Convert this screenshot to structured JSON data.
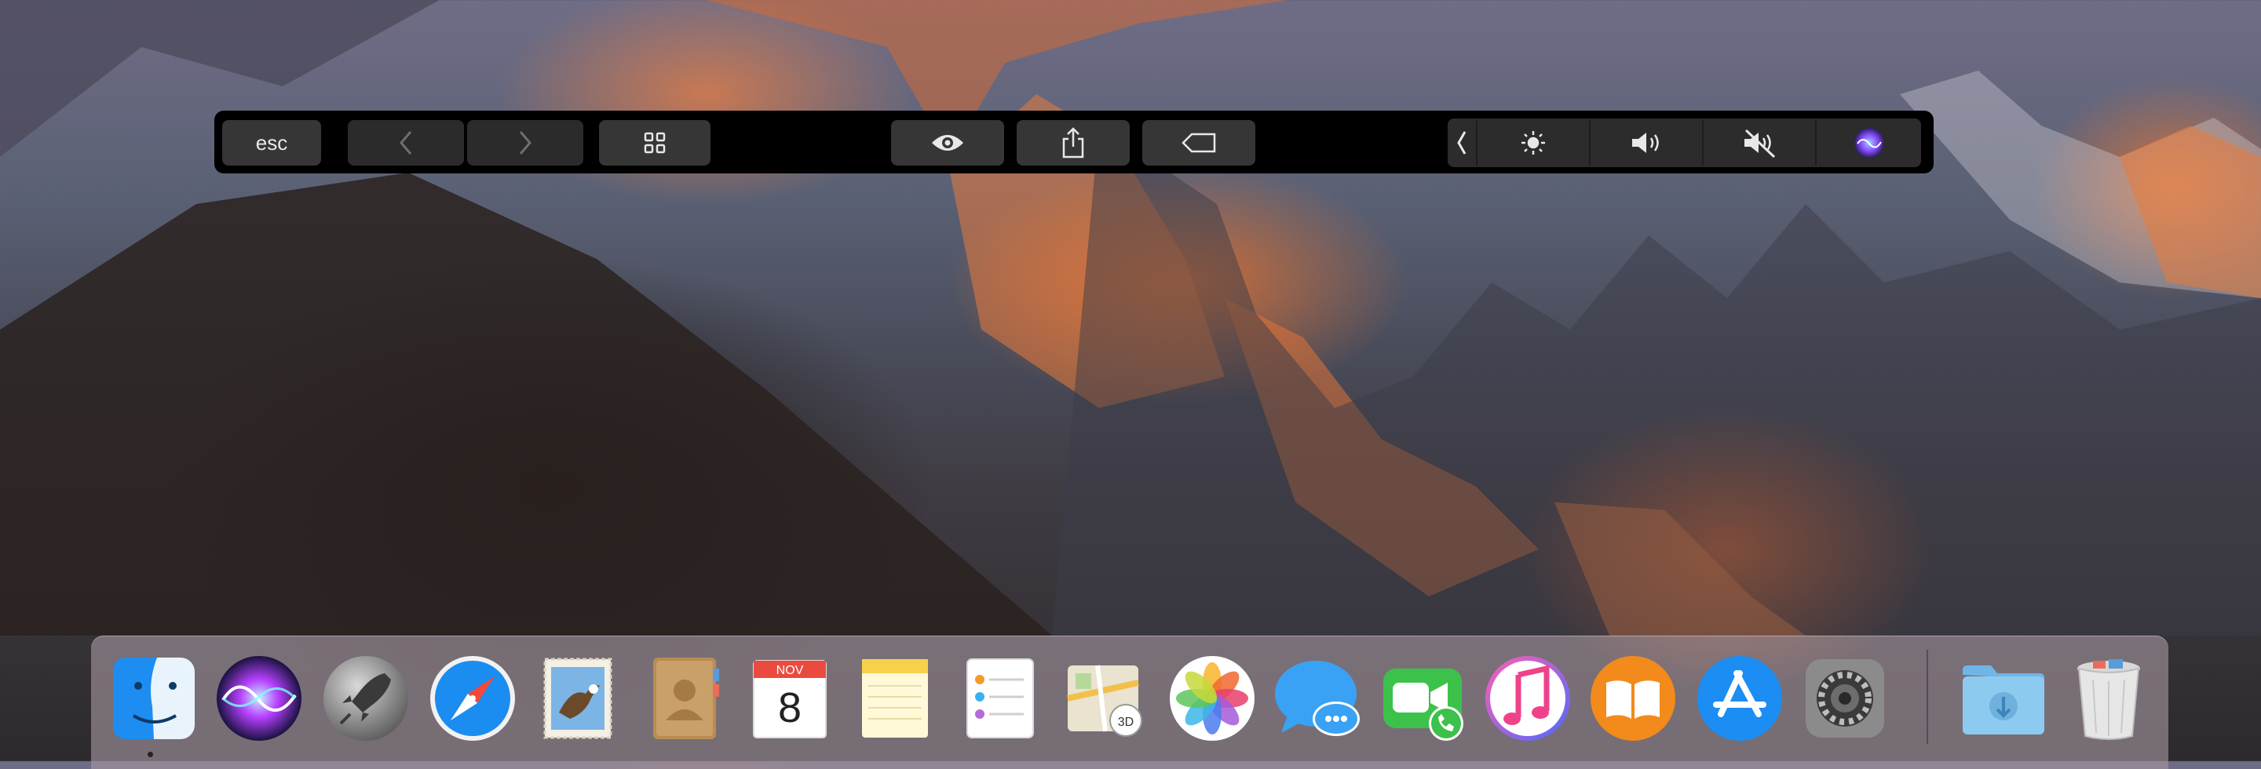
{
  "touchbar": {
    "esc_label": "esc",
    "keys": [
      {
        "icon": "back-arrow-icon",
        "enabled": false
      },
      {
        "icon": "forward-arrow-icon",
        "enabled": false
      },
      {
        "icon": "grid-view-icon",
        "enabled": true
      },
      {
        "icon": "eye-quicklook-icon",
        "enabled": true
      },
      {
        "icon": "share-icon",
        "enabled": true
      },
      {
        "icon": "tag-icon",
        "enabled": true
      }
    ],
    "control_strip": [
      "collapse-chevron-icon",
      "brightness-icon",
      "volume-icon",
      "mute-icon",
      "siri-icon"
    ]
  },
  "dock": {
    "apps": [
      "finder",
      "siri",
      "launchpad",
      "safari",
      "mail",
      "contacts",
      "calendar",
      "notes",
      "reminders",
      "maps",
      "photos",
      "messages",
      "facetime",
      "itunes",
      "ibooks",
      "app-store",
      "system-preferences"
    ],
    "calendar": {
      "month": "NOV",
      "day": "8"
    },
    "maps_badge": "3D",
    "running_indicator": "finder",
    "trailing": [
      "downloads-folder",
      "trash"
    ]
  },
  "colors": {
    "touchbar_bg": "#000000",
    "touchbar_key": "#363636",
    "dock_bg": "rgba(165,150,160,0.62)"
  }
}
